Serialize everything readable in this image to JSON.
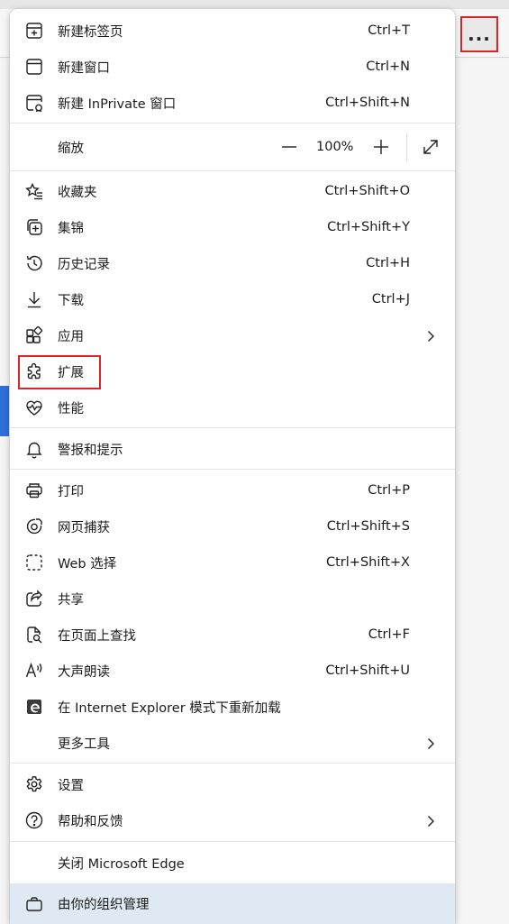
{
  "more_button": {
    "label": "...",
    "icon": "ellipsis-icon",
    "highlight_color": "#d8262a"
  },
  "menu": {
    "new_tab": {
      "label": "新建标签页",
      "shortcut": "Ctrl+T",
      "icon": "new-tab-icon"
    },
    "new_window": {
      "label": "新建窗口",
      "shortcut": "Ctrl+N",
      "icon": "window-icon"
    },
    "new_inprivate": {
      "label": "新建 InPrivate 窗口",
      "shortcut": "Ctrl+Shift+N",
      "icon": "inprivate-icon"
    },
    "zoom": {
      "label": "缩放",
      "value": "100%",
      "minus_icon": "minus-icon",
      "plus_icon": "plus-icon",
      "fullscreen_icon": "fullscreen-icon"
    },
    "favorites": {
      "label": "收藏夹",
      "shortcut": "Ctrl+Shift+O",
      "icon": "favorites-icon"
    },
    "collections": {
      "label": "集锦",
      "shortcut": "Ctrl+Shift+Y",
      "icon": "collections-icon"
    },
    "history": {
      "label": "历史记录",
      "shortcut": "Ctrl+H",
      "icon": "history-icon"
    },
    "downloads": {
      "label": "下载",
      "shortcut": "Ctrl+J",
      "icon": "download-icon"
    },
    "apps": {
      "label": "应用",
      "icon": "apps-icon"
    },
    "extensions": {
      "label": "扩展",
      "icon": "extensions-icon"
    },
    "performance": {
      "label": "性能",
      "icon": "performance-icon"
    },
    "alerts": {
      "label": "警报和提示",
      "icon": "bell-icon"
    },
    "print": {
      "label": "打印",
      "shortcut": "Ctrl+P",
      "icon": "printer-icon"
    },
    "web_capture": {
      "label": "网页捕获",
      "shortcut": "Ctrl+Shift+S",
      "icon": "web-capture-icon"
    },
    "web_select": {
      "label": "Web 选择",
      "shortcut": "Ctrl+Shift+X",
      "icon": "web-select-icon"
    },
    "share": {
      "label": "共享",
      "icon": "share-icon"
    },
    "find": {
      "label": "在页面上查找",
      "shortcut": "Ctrl+F",
      "icon": "find-icon"
    },
    "read_aloud": {
      "label": "大声朗读",
      "shortcut": "Ctrl+Shift+U",
      "icon": "read-aloud-icon"
    },
    "ie_mode": {
      "label": "在 Internet Explorer 模式下重新加载",
      "icon": "ie-icon"
    },
    "more_tools": {
      "label": "更多工具"
    },
    "settings": {
      "label": "设置",
      "icon": "gear-icon"
    },
    "help": {
      "label": "帮助和反馈",
      "icon": "help-icon"
    },
    "close_edge": {
      "label": "关闭 Microsoft Edge"
    },
    "managed": {
      "label": "由你的组织管理",
      "icon": "briefcase-icon"
    }
  }
}
